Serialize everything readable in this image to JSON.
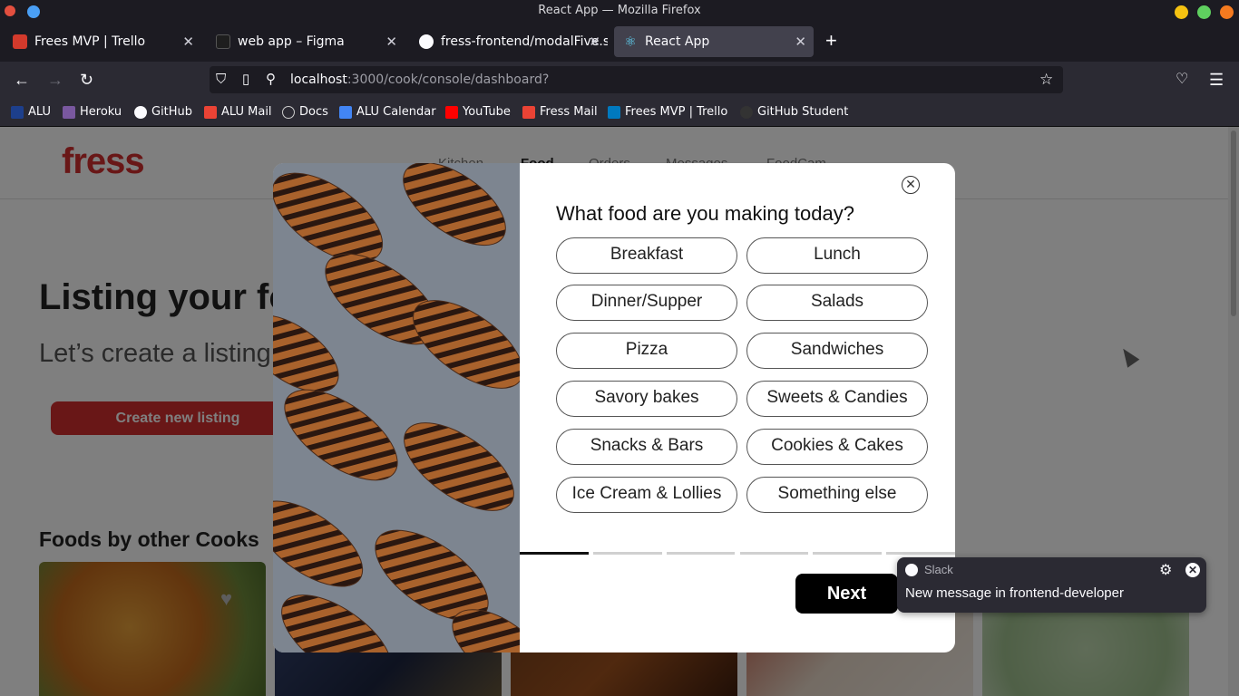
{
  "window": {
    "title": "React App — Mozilla Firefox"
  },
  "tabs": [
    {
      "label": "Frees MVP | Trello",
      "favicon": "trello-icon",
      "color": "#d33a2c"
    },
    {
      "label": "web app – Figma",
      "favicon": "figma-icon",
      "color": "#1e1e1e"
    },
    {
      "label": "fress-frontend/modalFive.s",
      "favicon": "github-icon",
      "color": "#ffffff"
    },
    {
      "label": "React App",
      "favicon": "react-icon",
      "color": "#61dafb"
    }
  ],
  "url": {
    "host": "localhost",
    "rest": ":3000/cook/console/dashboard?"
  },
  "bookmarks": [
    {
      "label": "ALU",
      "icon": "alu-icon",
      "color": "#1d3f8c"
    },
    {
      "label": "Heroku",
      "icon": "heroku-icon",
      "color": "#79589f"
    },
    {
      "label": "GitHub",
      "icon": "github-icon",
      "color": "#ffffff"
    },
    {
      "label": "ALU Mail",
      "icon": "gmail-icon",
      "color": "#ea4335"
    },
    {
      "label": "Docs",
      "icon": "globe-icon",
      "color": "#cccccc"
    },
    {
      "label": "ALU Calendar",
      "icon": "calendar-icon",
      "color": "#4285f4"
    },
    {
      "label": "YouTube",
      "icon": "youtube-icon",
      "color": "#ff0000"
    },
    {
      "label": "Fress Mail",
      "icon": "gmail-icon",
      "color": "#ea4335"
    },
    {
      "label": "Frees MVP | Trello",
      "icon": "trello-icon",
      "color": "#0079bf"
    },
    {
      "label": "GitHub Student",
      "icon": "github-icon",
      "color": "#333333"
    }
  ],
  "site": {
    "logo": "fress",
    "nav": [
      "Kitchen",
      "Food",
      "Orders",
      "Messages",
      "FoodCam"
    ],
    "hero_title": "Listing your foo",
    "hero_subtitle": "Let’s create a listing s",
    "create_button": "Create new listing",
    "section_title": "Foods by other Cooks"
  },
  "modal": {
    "question": "What food are you making today?",
    "options": [
      "Breakfast",
      "Lunch",
      "Dinner/Supper",
      "Salads",
      "Pizza",
      "Sandwiches",
      "Savory bakes",
      "Sweets & Candies",
      "Snacks & Bars",
      "Cookies & Cakes",
      "Ice Cream & Lollies",
      "Something else"
    ],
    "progress": {
      "step": 1,
      "total": 6
    },
    "next_button": "Next"
  },
  "notification": {
    "app": "Slack",
    "message": "New message in frontend-developer"
  },
  "colors": {
    "brand": "#d32f2f",
    "modal_button": "#000000"
  }
}
